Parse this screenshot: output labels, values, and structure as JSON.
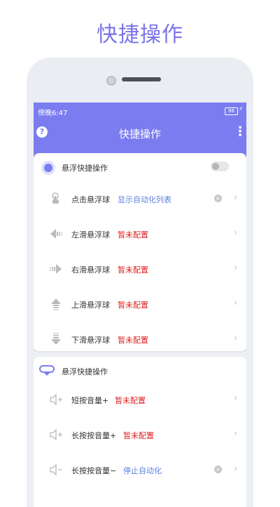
{
  "promo": {
    "title": "快捷操作"
  },
  "status": {
    "time": "傍晚6:47",
    "battery": "86"
  },
  "header": {
    "title": "快捷操作"
  },
  "card1": {
    "title": "悬浮快捷操作",
    "rows": [
      {
        "label": "点击悬浮球",
        "value": "显示自动化列表"
      },
      {
        "label": "左滑悬浮球",
        "value": "暂未配置"
      },
      {
        "label": "右滑悬浮球",
        "value": "暂未配置"
      },
      {
        "label": "上滑悬浮球",
        "value": "暂未配置"
      },
      {
        "label": "下滑悬浮球",
        "value": "暂未配置"
      }
    ]
  },
  "card2": {
    "title": "悬浮快捷操作",
    "rows": [
      {
        "label": "短按音量+",
        "value": "暂未配置"
      },
      {
        "label": "长按按音量+",
        "value": "暂未配置"
      },
      {
        "label": "长按按音量−",
        "value": "停止自动化"
      }
    ]
  },
  "icons": {
    "tap": "tap-icon",
    "swipe_left": "arrow-left-icon",
    "swipe_right": "arrow-right-icon",
    "swipe_up": "arrow-up-icon",
    "swipe_down": "arrow-down-icon",
    "volume": "volume-icon"
  },
  "colors": {
    "accent": "#7b7cf0",
    "value_blue": "#5b7fe0",
    "value_red": "#e02020"
  }
}
